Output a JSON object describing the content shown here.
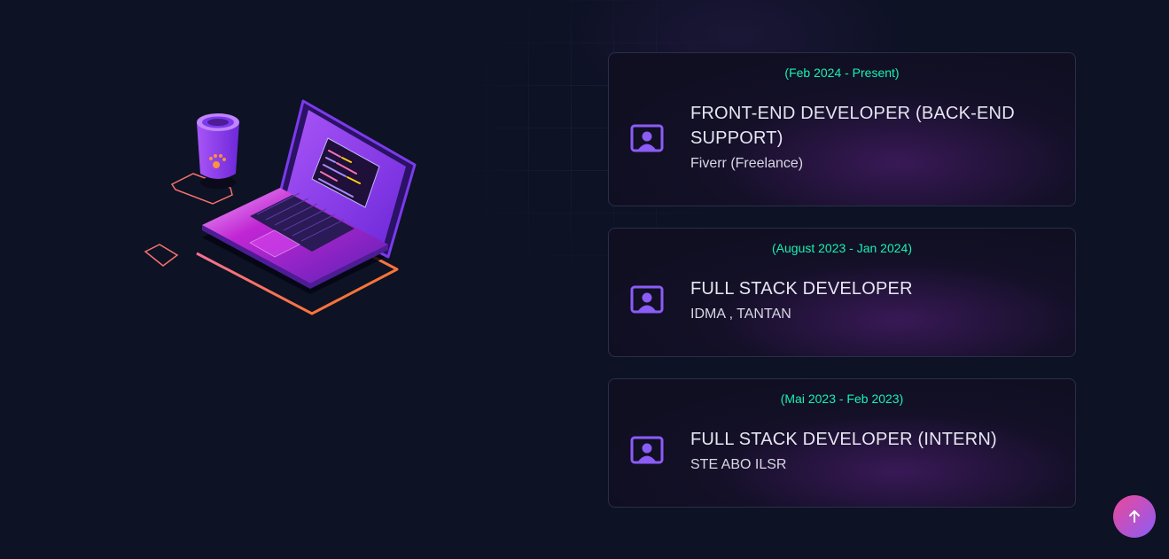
{
  "experience": [
    {
      "period": "(Feb 2024 - Present)",
      "title": "FRONT-END DEVELOPER (BACK-END SUPPORT)",
      "company": "Fiverr (Freelance)"
    },
    {
      "period": "(August 2023 - Jan 2024)",
      "title": "FULL STACK DEVELOPER",
      "company": "IDMA , TANTAN"
    },
    {
      "period": "(Mai 2023 - Feb 2023)",
      "title": "FULL STACK DEVELOPER (INTERN)",
      "company": "STE ABO ILSR"
    }
  ],
  "icons": {
    "experience": "user-square-icon",
    "scroll_top": "arrow-up-icon",
    "illustration": "laptop-coffee-illustration"
  },
  "colors": {
    "background": "#0d1224",
    "period_accent": "#16f2b3",
    "icon_accent": "#8b5cf6",
    "scroll_button_from": "#ec4899",
    "scroll_button_to": "#8b5cf6"
  }
}
